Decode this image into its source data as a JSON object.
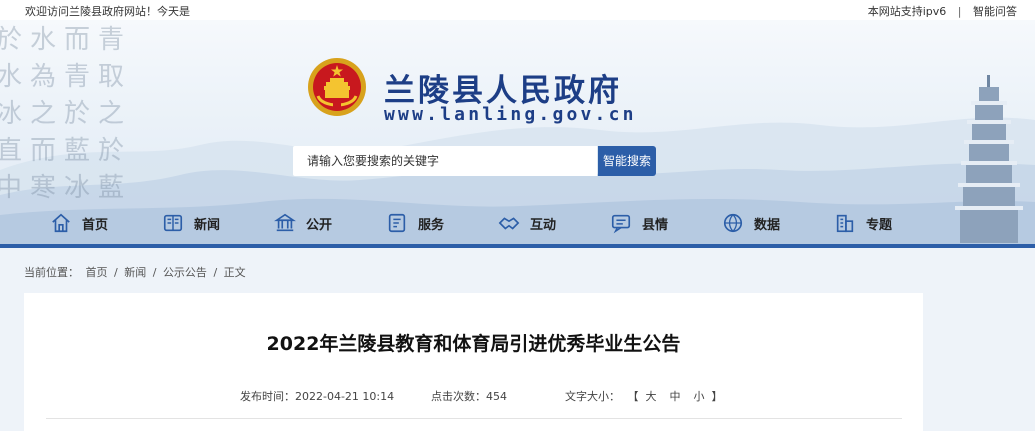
{
  "topbar": {
    "welcome": "欢迎访问兰陵县政府网站！今天是",
    "ipv6": "本网站支持ipv6",
    "separator": "|",
    "qa": "智能问答"
  },
  "header": {
    "title": "兰陵县人民政府",
    "url": "www.lanling.gov.cn",
    "calligraphy": [
      "於水而青",
      "水為青取",
      "冰之於之",
      "直而藍於",
      "中寒冰藍"
    ]
  },
  "search": {
    "placeholder": "请输入您要搜索的关键字",
    "button": "智能搜索"
  },
  "nav": {
    "items": [
      {
        "label": "首页",
        "icon": "home-icon"
      },
      {
        "label": "新闻",
        "icon": "newspaper-icon"
      },
      {
        "label": "公开",
        "icon": "government-building-icon"
      },
      {
        "label": "服务",
        "icon": "document-icon"
      },
      {
        "label": "互动",
        "icon": "handshake-icon"
      },
      {
        "label": "县情",
        "icon": "chat-icon"
      },
      {
        "label": "数据",
        "icon": "globe-icon"
      },
      {
        "label": "专题",
        "icon": "buildings-icon"
      }
    ]
  },
  "breadcrumb": {
    "prefix": "当前位置：",
    "items": [
      "首页",
      "新闻",
      "公示公告",
      "正文"
    ],
    "separator": "/"
  },
  "article": {
    "title": "2022年兰陵县教育和体育局引进优秀毕业生公告",
    "publish_label": "发布时间：",
    "publish_time": "2022-04-21 10:14",
    "clicks_label": "点击次数：",
    "clicks": "454",
    "font_label": "文字大小：",
    "font_open": "【",
    "font_large": "大",
    "font_medium": "中",
    "font_small": "小",
    "font_close": "】"
  },
  "colors": {
    "brand_blue": "#1d3e86",
    "nav_line": "#2c5ea8",
    "search_button": "#2c5ea8"
  }
}
